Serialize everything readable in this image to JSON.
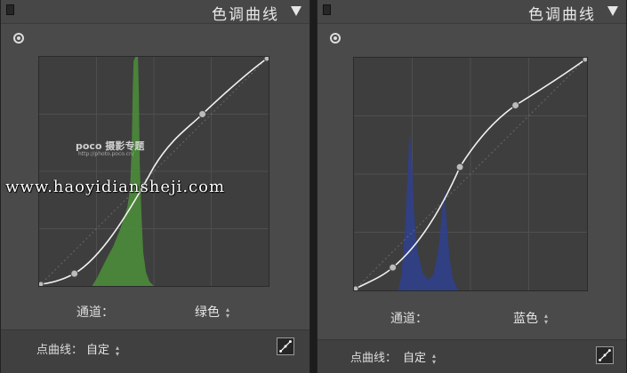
{
  "panels": [
    {
      "title": "色调曲线",
      "channel_label": "通道：",
      "channel_value": "绿色",
      "point_curve_label": "点曲线：",
      "point_curve_value": "自定",
      "histogram_color": "#4c8f3a"
    },
    {
      "title": "色调曲线",
      "channel_label": "通道：",
      "channel_value": "蓝色",
      "point_curve_label": "点曲线：",
      "point_curve_value": "自定",
      "histogram_color": "#2f3f8f"
    }
  ],
  "watermarks": {
    "logo_text": "poco 摄影专题",
    "logo_url": "http://photo.poco.cn/",
    "site_text": "www.haoyidiansheji.com"
  },
  "icons": {
    "collapse": "triangle-down-icon",
    "target": "target-adjust-icon",
    "edit": "point-curve-edit-icon",
    "toggle": "panel-toggle-icon"
  }
}
